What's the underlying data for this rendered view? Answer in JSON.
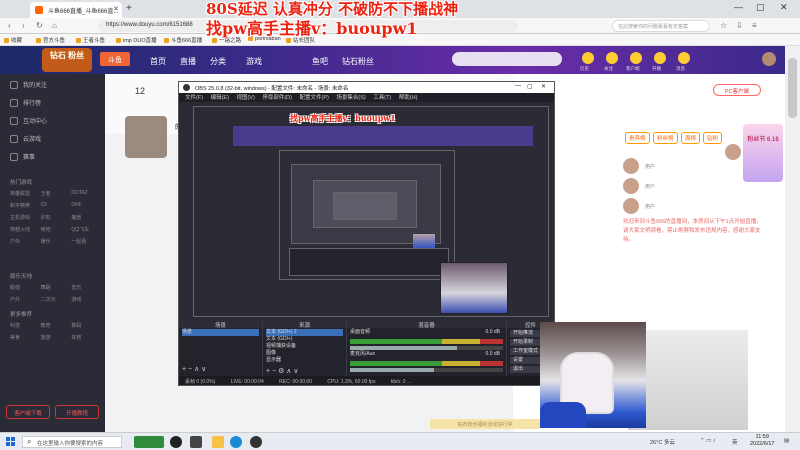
{
  "browser": {
    "tab_title": "斗鱼666直播_斗鱼666直...",
    "url": "https://www.douyu.com/6151688",
    "search_placeholder": "在此搜索你的问题看看有无答案",
    "bookmarks": [
      "收藏",
      "官方斗鱼",
      "王者斗鱼",
      "imp DUO直播",
      "斗鱼666直播",
      "一路之路",
      "poriniaban",
      "站长团队"
    ]
  },
  "site": {
    "logo_text": "钻石 粉丝",
    "logo_badge": "斗鱼",
    "nav": [
      "首页",
      "直播",
      "分类",
      "游戏",
      "鱼吧",
      "钻石粉丝"
    ],
    "header_actions": [
      "历史",
      "关注",
      "客户端",
      "开播",
      "消息"
    ]
  },
  "sidebar": {
    "items": [
      "我的关注",
      "排行榜",
      "互动中心",
      "云游戏",
      "赛事"
    ],
    "section_hot": "热门游戏",
    "hot_grid": [
      "英雄联盟",
      "王者",
      "DOTA2",
      "和平精英",
      "CF",
      "DNF",
      "主机游戏",
      "炉石",
      "魔兽",
      "穿越火线",
      "绝地",
      "QQ飞车",
      "户外",
      "娱乐",
      "一起看"
    ],
    "section_ent": "娱乐天地",
    "ent_grid": [
      "颜值",
      "舞蹈",
      "音乐",
      "户外",
      "二次元",
      "游戏"
    ],
    "section_more": "更多推荐",
    "more_grid": [
      "科技",
      "教育",
      "数码",
      "美食",
      "旅游",
      "体育"
    ],
    "btn_left": "客户端下载",
    "btn_right": "开播教程"
  },
  "main": {
    "rank_num": "12",
    "streamer_name": "皖",
    "stream_badge": "PC客户端",
    "notice_text": "欢迎来到斗鱼666的直播间，本房间从下午1点开始直播，请大家文明观看，禁止刷屏和发布违规内容，感谢大家支持。",
    "banner_text": "粉丝节 6.16",
    "tabs": [
      "贵宾榜",
      "粉丝榜",
      "周榜",
      "钻粉"
    ],
    "viewers": [
      "用户",
      "用户",
      "用户",
      "用户"
    ],
    "bottom_banner": "钻石粉丝福利活动进行中"
  },
  "obs": {
    "title": "OBS 25.0.8 (32-bit, windows) - 配置文件: 未命名 - 场景: 未命名",
    "menu": [
      "文件(F)",
      "编辑(E)",
      "视图(V)",
      "停靠部件(D)",
      "配置文件(P)",
      "场景集合(S)",
      "工具(T)",
      "帮助(H)"
    ],
    "docks": {
      "scenes_header": "场景",
      "scenes": [
        "场景"
      ],
      "sources_header": "来源",
      "sources": [
        "文本 (GDI+) 2",
        "文本 (GDI+)",
        "视频捕获设备",
        "图像",
        "显示器"
      ],
      "mixer_header": "混音器",
      "mixer": [
        {
          "name": "桌面音频",
          "db": "0.0 dB",
          "level": 0.7
        },
        {
          "name": "麦克风/Aux",
          "db": "0.0 dB",
          "level": 0.55
        }
      ],
      "transitions_header": "转场",
      "controls_header": "控件",
      "controls": [
        "开始推流",
        "开始录制",
        "工作室模式",
        "设置",
        "退出"
      ]
    },
    "status": {
      "dropped": "丢帧 0 (0.0%)",
      "live": "LIVE: 00:00:04",
      "rec": "REC: 00:00:00",
      "cpu": "CPU: 1.3%, 60.00 fps",
      "kbps": "kb/s: 0 ..."
    }
  },
  "overlays": {
    "line1": "80S延迟  认真冲分 不破防不下播战神",
    "line2": "找pw高手主播v：buoupw1"
  },
  "taskbar": {
    "search_placeholder": "在这里输入你要搜索的内容",
    "weather": "26°C 多云",
    "lang": "英",
    "time": "11:59",
    "date": "2022/6/17"
  },
  "colors": {
    "overlay_red": "#e21111",
    "obs_bg": "#2a2a34",
    "site_header": "#3b2a8a"
  }
}
